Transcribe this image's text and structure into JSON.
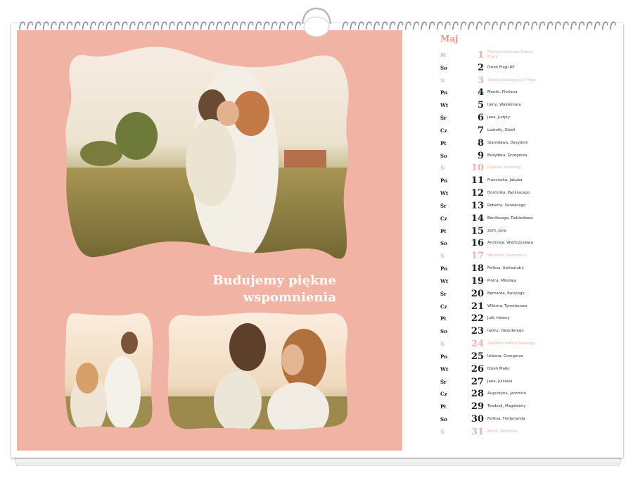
{
  "headline": [
    "Budujemy piękne",
    "wspomnienia"
  ],
  "month": "Maj",
  "colors": {
    "panel": "#f1b3a4",
    "holiday": "#eeb3a5",
    "month": "#e39a8a"
  },
  "days": [
    {
      "dn": "Pt",
      "num": "1",
      "names": "Międzynarodowe Święto Pracy",
      "holiday": true
    },
    {
      "dn": "So",
      "num": "2",
      "names": "Dzień Flagi RP",
      "holiday": false
    },
    {
      "dn": "N",
      "num": "3",
      "names": "Święto Konstytucji 3 Maja",
      "holiday": true
    },
    {
      "dn": "Pn",
      "num": "4",
      "names": "Moniki, Floriana",
      "holiday": false
    },
    {
      "dn": "Wt",
      "num": "5",
      "names": "Ireny, Waldemara",
      "holiday": false
    },
    {
      "dn": "Śr",
      "num": "6",
      "names": "Jana, Judyty",
      "holiday": false
    },
    {
      "dn": "Cz",
      "num": "7",
      "names": "Ludmiły, Gizeli",
      "holiday": false
    },
    {
      "dn": "Pt",
      "num": "8",
      "names": "Stanisława, Dezyderii",
      "holiday": false
    },
    {
      "dn": "So",
      "num": "9",
      "names": "Bożydara, Grzegorza",
      "holiday": false
    },
    {
      "dn": "N",
      "num": "10",
      "names": "Izydora, Antoniny",
      "holiday": true
    },
    {
      "dn": "Pn",
      "num": "11",
      "names": "Franciszka, Jakuba",
      "holiday": false
    },
    {
      "dn": "Wt",
      "num": "12",
      "names": "Dominika, Pankracego",
      "holiday": false
    },
    {
      "dn": "Śr",
      "num": "13",
      "names": "Roberta, Serwacego",
      "holiday": false
    },
    {
      "dn": "Cz",
      "num": "14",
      "names": "Bonifacego, Dobiesława",
      "holiday": false
    },
    {
      "dn": "Pt",
      "num": "15",
      "names": "Zofii, Jana",
      "holiday": false
    },
    {
      "dn": "So",
      "num": "16",
      "names": "Andrzeja, Wieńczysława",
      "holiday": false
    },
    {
      "dn": "N",
      "num": "17",
      "names": "Weroniki, Sławomira",
      "holiday": true
    },
    {
      "dn": "Pn",
      "num": "18",
      "names": "Feliksa, Aleksandry",
      "holiday": false
    },
    {
      "dn": "Wt",
      "num": "19",
      "names": "Piotra, Mikołaja",
      "holiday": false
    },
    {
      "dn": "Śr",
      "num": "20",
      "names": "Bernarda, Bazylego",
      "holiday": false
    },
    {
      "dn": "Cz",
      "num": "21",
      "names": "Wiktora, Tymoteusza",
      "holiday": false
    },
    {
      "dn": "Pt",
      "num": "22",
      "names": "Julii, Heleny",
      "holiday": false
    },
    {
      "dn": "So",
      "num": "23",
      "names": "Iwony, Dezyderego",
      "holiday": false
    },
    {
      "dn": "N",
      "num": "24",
      "names": "Zesłanie Ducha Świętego",
      "holiday": true
    },
    {
      "dn": "Pn",
      "num": "25",
      "names": "Urbana, Grzegorza",
      "holiday": false
    },
    {
      "dn": "Wt",
      "num": "26",
      "names": "Dzień Matki",
      "holiday": false
    },
    {
      "dn": "Śr",
      "num": "27",
      "names": "Jana, Juliusza",
      "holiday": false
    },
    {
      "dn": "Cz",
      "num": "28",
      "names": "Augustyna, Jaromira",
      "holiday": false
    },
    {
      "dn": "Pt",
      "num": "29",
      "names": "Teodozji, Magdaleny",
      "holiday": false
    },
    {
      "dn": "So",
      "num": "30",
      "names": "Feliksa, Ferdynanda",
      "holiday": false
    },
    {
      "dn": "N",
      "num": "31",
      "names": "Anieli, Petroneli",
      "holiday": true
    }
  ]
}
